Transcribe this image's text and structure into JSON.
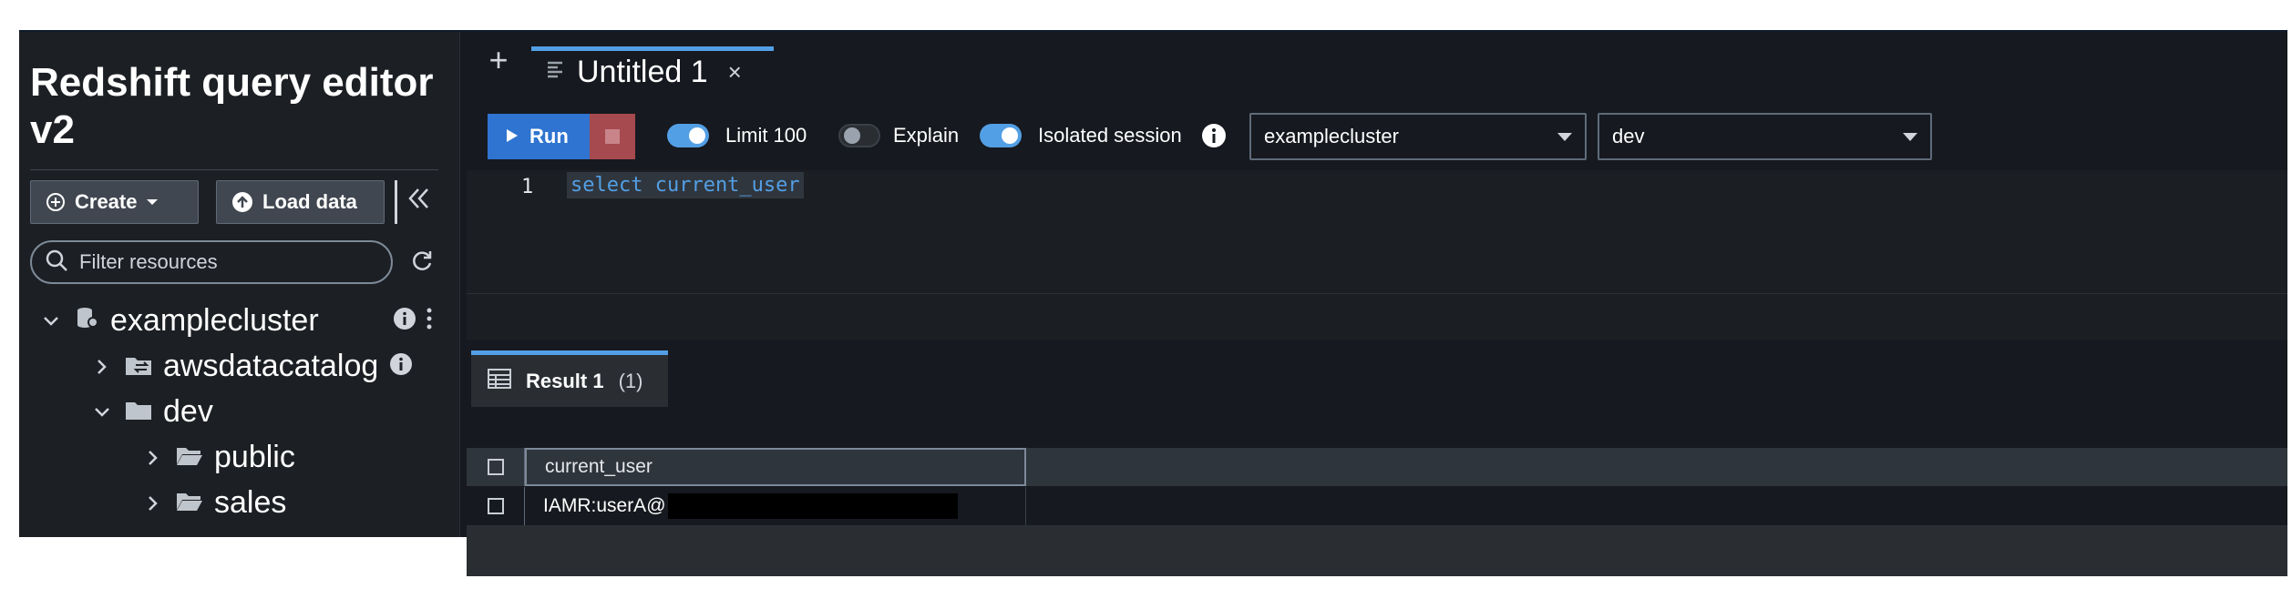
{
  "sidebar": {
    "app_title": "Redshift query editor v2",
    "create_label": "Create",
    "load_label": "Load data",
    "filter_placeholder": "Filter resources",
    "tree": {
      "cluster": "examplecluster",
      "awsdatacatalog": "awsdatacatalog",
      "dev": "dev",
      "public": "public",
      "sales": "sales"
    }
  },
  "editor": {
    "tab_title": "Untitled 1",
    "run_label": "Run",
    "limit_label": "Limit 100",
    "limit_on": true,
    "explain_label": "Explain",
    "explain_on": false,
    "isolated_label": "Isolated session",
    "isolated_on": true,
    "cluster_select": "examplecluster",
    "database_select": "dev",
    "line_number": "1",
    "query": "select current_user"
  },
  "results": {
    "tab_label": "Result 1",
    "tab_count": "(1)",
    "columns": [
      "current_user"
    ],
    "rows": [
      [
        "IAMR:userA@"
      ]
    ]
  },
  "colors": {
    "accent": "#539fe5",
    "run_button": "#2f74d0",
    "stop_button": "#a64a4f",
    "background": "#16191f"
  }
}
